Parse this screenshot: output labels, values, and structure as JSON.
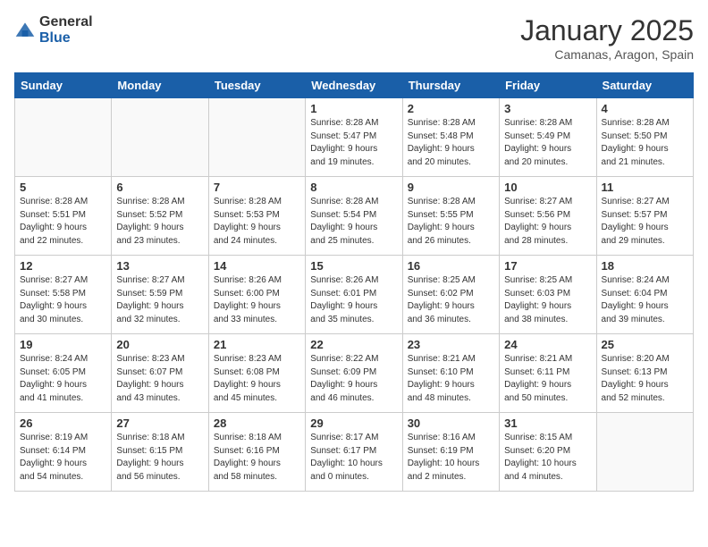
{
  "header": {
    "logo_general": "General",
    "logo_blue": "Blue",
    "month_title": "January 2025",
    "subtitle": "Camanas, Aragon, Spain"
  },
  "weekdays": [
    "Sunday",
    "Monday",
    "Tuesday",
    "Wednesday",
    "Thursday",
    "Friday",
    "Saturday"
  ],
  "weeks": [
    [
      {
        "day": "",
        "info": ""
      },
      {
        "day": "",
        "info": ""
      },
      {
        "day": "",
        "info": ""
      },
      {
        "day": "1",
        "info": "Sunrise: 8:28 AM\nSunset: 5:47 PM\nDaylight: 9 hours\nand 19 minutes."
      },
      {
        "day": "2",
        "info": "Sunrise: 8:28 AM\nSunset: 5:48 PM\nDaylight: 9 hours\nand 20 minutes."
      },
      {
        "day": "3",
        "info": "Sunrise: 8:28 AM\nSunset: 5:49 PM\nDaylight: 9 hours\nand 20 minutes."
      },
      {
        "day": "4",
        "info": "Sunrise: 8:28 AM\nSunset: 5:50 PM\nDaylight: 9 hours\nand 21 minutes."
      }
    ],
    [
      {
        "day": "5",
        "info": "Sunrise: 8:28 AM\nSunset: 5:51 PM\nDaylight: 9 hours\nand 22 minutes."
      },
      {
        "day": "6",
        "info": "Sunrise: 8:28 AM\nSunset: 5:52 PM\nDaylight: 9 hours\nand 23 minutes."
      },
      {
        "day": "7",
        "info": "Sunrise: 8:28 AM\nSunset: 5:53 PM\nDaylight: 9 hours\nand 24 minutes."
      },
      {
        "day": "8",
        "info": "Sunrise: 8:28 AM\nSunset: 5:54 PM\nDaylight: 9 hours\nand 25 minutes."
      },
      {
        "day": "9",
        "info": "Sunrise: 8:28 AM\nSunset: 5:55 PM\nDaylight: 9 hours\nand 26 minutes."
      },
      {
        "day": "10",
        "info": "Sunrise: 8:27 AM\nSunset: 5:56 PM\nDaylight: 9 hours\nand 28 minutes."
      },
      {
        "day": "11",
        "info": "Sunrise: 8:27 AM\nSunset: 5:57 PM\nDaylight: 9 hours\nand 29 minutes."
      }
    ],
    [
      {
        "day": "12",
        "info": "Sunrise: 8:27 AM\nSunset: 5:58 PM\nDaylight: 9 hours\nand 30 minutes."
      },
      {
        "day": "13",
        "info": "Sunrise: 8:27 AM\nSunset: 5:59 PM\nDaylight: 9 hours\nand 32 minutes."
      },
      {
        "day": "14",
        "info": "Sunrise: 8:26 AM\nSunset: 6:00 PM\nDaylight: 9 hours\nand 33 minutes."
      },
      {
        "day": "15",
        "info": "Sunrise: 8:26 AM\nSunset: 6:01 PM\nDaylight: 9 hours\nand 35 minutes."
      },
      {
        "day": "16",
        "info": "Sunrise: 8:25 AM\nSunset: 6:02 PM\nDaylight: 9 hours\nand 36 minutes."
      },
      {
        "day": "17",
        "info": "Sunrise: 8:25 AM\nSunset: 6:03 PM\nDaylight: 9 hours\nand 38 minutes."
      },
      {
        "day": "18",
        "info": "Sunrise: 8:24 AM\nSunset: 6:04 PM\nDaylight: 9 hours\nand 39 minutes."
      }
    ],
    [
      {
        "day": "19",
        "info": "Sunrise: 8:24 AM\nSunset: 6:05 PM\nDaylight: 9 hours\nand 41 minutes."
      },
      {
        "day": "20",
        "info": "Sunrise: 8:23 AM\nSunset: 6:07 PM\nDaylight: 9 hours\nand 43 minutes."
      },
      {
        "day": "21",
        "info": "Sunrise: 8:23 AM\nSunset: 6:08 PM\nDaylight: 9 hours\nand 45 minutes."
      },
      {
        "day": "22",
        "info": "Sunrise: 8:22 AM\nSunset: 6:09 PM\nDaylight: 9 hours\nand 46 minutes."
      },
      {
        "day": "23",
        "info": "Sunrise: 8:21 AM\nSunset: 6:10 PM\nDaylight: 9 hours\nand 48 minutes."
      },
      {
        "day": "24",
        "info": "Sunrise: 8:21 AM\nSunset: 6:11 PM\nDaylight: 9 hours\nand 50 minutes."
      },
      {
        "day": "25",
        "info": "Sunrise: 8:20 AM\nSunset: 6:13 PM\nDaylight: 9 hours\nand 52 minutes."
      }
    ],
    [
      {
        "day": "26",
        "info": "Sunrise: 8:19 AM\nSunset: 6:14 PM\nDaylight: 9 hours\nand 54 minutes."
      },
      {
        "day": "27",
        "info": "Sunrise: 8:18 AM\nSunset: 6:15 PM\nDaylight: 9 hours\nand 56 minutes."
      },
      {
        "day": "28",
        "info": "Sunrise: 8:18 AM\nSunset: 6:16 PM\nDaylight: 9 hours\nand 58 minutes."
      },
      {
        "day": "29",
        "info": "Sunrise: 8:17 AM\nSunset: 6:17 PM\nDaylight: 10 hours\nand 0 minutes."
      },
      {
        "day": "30",
        "info": "Sunrise: 8:16 AM\nSunset: 6:19 PM\nDaylight: 10 hours\nand 2 minutes."
      },
      {
        "day": "31",
        "info": "Sunrise: 8:15 AM\nSunset: 6:20 PM\nDaylight: 10 hours\nand 4 minutes."
      },
      {
        "day": "",
        "info": ""
      }
    ]
  ]
}
